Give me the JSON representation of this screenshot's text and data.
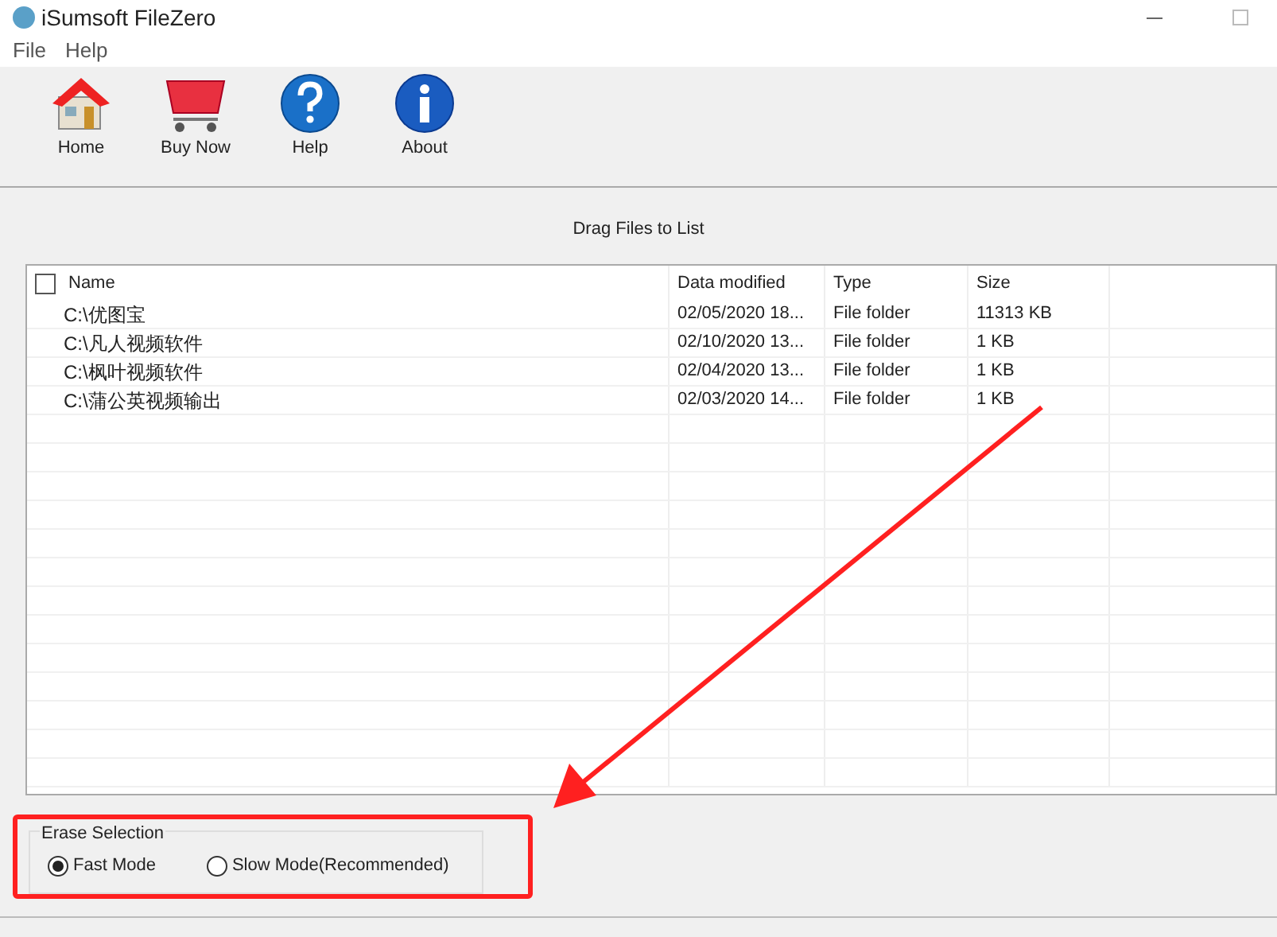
{
  "window": {
    "title": "iSumsoft FileZero"
  },
  "menu": [
    "File",
    "Help"
  ],
  "toolbar": [
    {
      "kind": "home",
      "label": "Home"
    },
    {
      "kind": "cart",
      "label": "Buy Now"
    },
    {
      "kind": "help",
      "label": "Help"
    },
    {
      "kind": "about",
      "label": "About"
    }
  ],
  "drop_hint": "Drag Files to List",
  "table": {
    "select_all_checked": false,
    "columns": [
      "Name",
      "Data modified",
      "Type",
      "Size"
    ],
    "rows": [
      [
        "C:\\优图宝",
        "02/05/2020 18...",
        "File folder",
        "11313 KB"
      ],
      [
        "C:\\凡人视频软件",
        "02/10/2020 13...",
        "File folder",
        "1 KB"
      ],
      [
        "C:\\枫叶视频软件",
        "02/04/2020 13...",
        "File folder",
        "1 KB"
      ],
      [
        "C:\\蒲公英视频输出",
        "02/03/2020 14...",
        "File folder",
        "1 KB"
      ]
    ]
  },
  "erase_selection": {
    "title": "Erase Selection",
    "options": [
      {
        "label": "Fast Mode",
        "selected": true
      },
      {
        "label": "Slow Mode(Recommended)",
        "selected": false
      }
    ]
  }
}
